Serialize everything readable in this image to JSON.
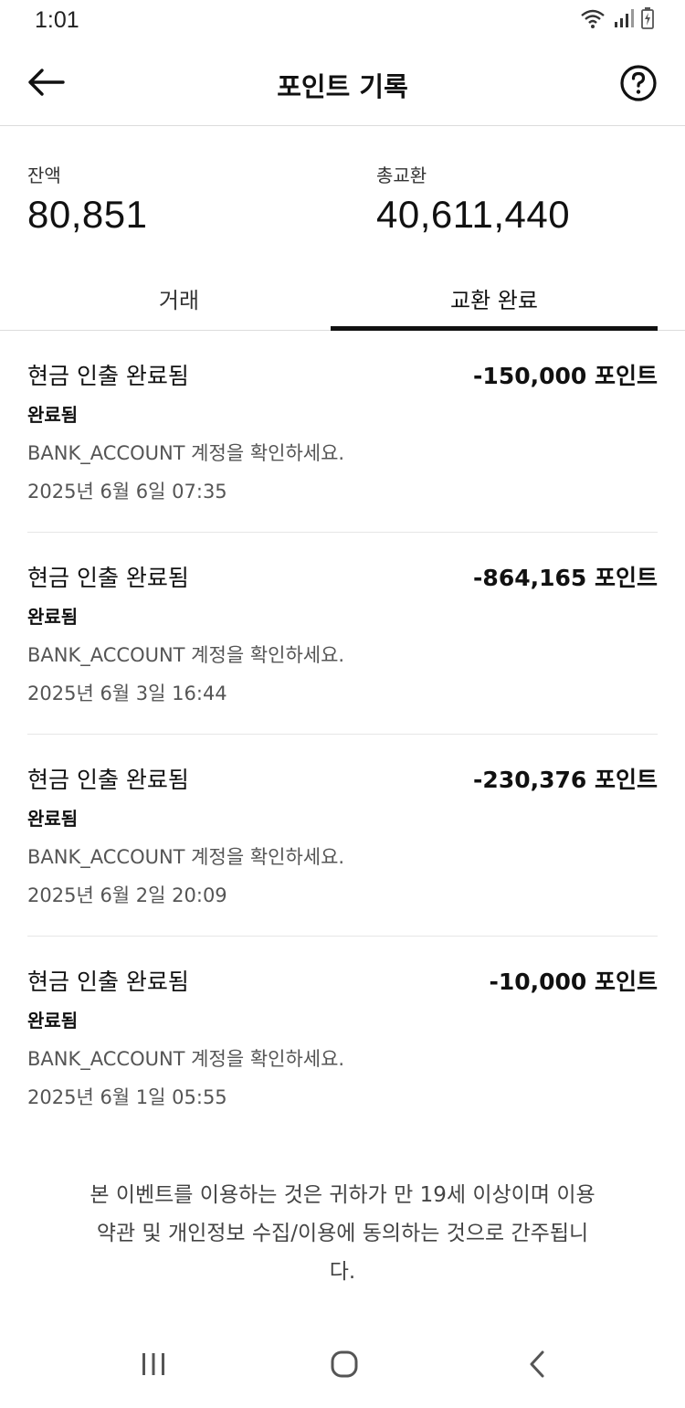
{
  "status_bar": {
    "time": "1:01",
    "icons": [
      "wifi-icon",
      "signal-icon",
      "battery-icon"
    ]
  },
  "app_bar": {
    "title": "포인트 기록",
    "back_icon": "arrow-left-icon",
    "help_icon": "question-circle-icon"
  },
  "summary": {
    "balance_label": "잔액",
    "balance_value": "80,851",
    "total_label": "총교환",
    "total_value": "40,611,440"
  },
  "tabs": [
    {
      "label": "거래",
      "selected": false
    },
    {
      "label": "교환 완료",
      "selected": true
    }
  ],
  "records": [
    {
      "title": "현금 인출 완료됨",
      "amount": "-150,000 포인트",
      "status": "완료됨",
      "desc": "BANK_ACCOUNT 계정을 확인하세요.",
      "date": "2025년 6월 6일 07:35"
    },
    {
      "title": "현금 인출 완료됨",
      "amount": "-864,165 포인트",
      "status": "완료됨",
      "desc": "BANK_ACCOUNT 계정을 확인하세요.",
      "date": "2025년 6월 3일 16:44"
    },
    {
      "title": "현금 인출 완료됨",
      "amount": "-230,376 포인트",
      "status": "완료됨",
      "desc": "BANK_ACCOUNT 계정을 확인하세요.",
      "date": "2025년 6월 2일 20:09"
    },
    {
      "title": "현금 인출 완료됨",
      "amount": "-10,000 포인트",
      "status": "완료됨",
      "desc": "BANK_ACCOUNT 계정을 확인하세요.",
      "date": "2025년 6월 1일 05:55"
    }
  ],
  "footer": {
    "line1": "본 이벤트를 이용하는 것은 귀하가 만 19세 이상이며 이용",
    "line2": "약관 및 개인정보 수집/이용에 동의하는 것으로 간주됩니",
    "line3": "다."
  },
  "nav_bar": {
    "icons": [
      "recent-apps-icon",
      "home-icon",
      "back-icon"
    ]
  }
}
